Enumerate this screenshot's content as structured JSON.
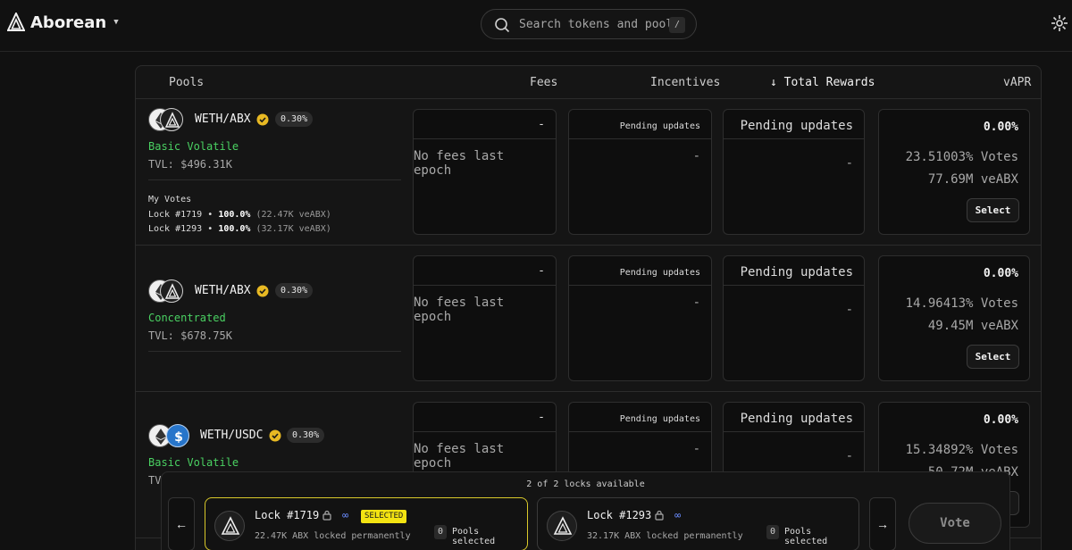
{
  "app": {
    "name": "Aborean"
  },
  "search": {
    "placeholder": "Search tokens and pools",
    "shortcut": "/"
  },
  "table": {
    "headers": {
      "pools": "Pools",
      "fees": "Fees",
      "incentives": "Incentives",
      "total_rewards": "↓ Total Rewards",
      "vapr": "vAPR"
    },
    "rows": [
      {
        "pair": "WETH/ABX",
        "fee": "0.30%",
        "type": "Basic Volatile",
        "tvl": "TVL: $496.31K",
        "my_votes_title": "My Votes",
        "votes": [
          {
            "lock": "Lock #1719",
            "sep": "•",
            "pct": "100.0%",
            "amount": "(22.47K veABX)"
          },
          {
            "lock": "Lock #1293",
            "sep": "•",
            "pct": "100.0%",
            "amount": "(32.17K veABX)"
          }
        ],
        "fees_top": "-",
        "fees_mid": "No fees last epoch",
        "inc_top": "Pending updates",
        "inc_mid": "-",
        "rew_top": "Pending updates",
        "rew_mid": "-",
        "vapr": "0.00%",
        "votes_pct": "23.51003% Votes",
        "veabx": "77.69M veABX",
        "select_label": "Select"
      },
      {
        "pair": "WETH/ABX",
        "fee": "0.30%",
        "type": "Concentrated",
        "tvl": "TVL: $678.75K",
        "fees_top": "-",
        "fees_mid": "No fees last epoch",
        "inc_top": "Pending updates",
        "inc_mid": "-",
        "rew_top": "Pending updates",
        "rew_mid": "-",
        "vapr": "0.00%",
        "votes_pct": "14.96413% Votes",
        "veabx": "49.45M veABX",
        "select_label": "Select"
      },
      {
        "pair": "WETH/USDC",
        "fee": "0.30%",
        "type": "Basic Volatile",
        "tvl": "TVL",
        "fees_top": "-",
        "fees_mid": "No fees last epoch",
        "inc_top": "Pending updates",
        "inc_mid": "-",
        "rew_top": "Pending updates",
        "rew_mid": "-",
        "vapr": "0.00%",
        "votes_pct": "15.34892% Votes",
        "veabx": "50.72M veABX",
        "select_label": "Select"
      }
    ]
  },
  "dock": {
    "title": "2 of 2 locks available",
    "prev": "←",
    "next": "→",
    "locks": [
      {
        "name": "Lock #1719",
        "infinity": "∞",
        "badge": "SELECTED",
        "sub": "22.47K ABX locked permanently",
        "count": "0",
        "pools_label": "Pools selected"
      },
      {
        "name": "Lock #1293",
        "infinity": "∞",
        "sub": "32.17K ABX locked permanently",
        "count": "0",
        "pools_label": "Pools selected"
      }
    ],
    "vote_label": "Vote"
  },
  "colors": {
    "accent_green": "#4ad162",
    "selected_yellow": "#f3e312",
    "verified_gold": "#e8b923",
    "usdc_blue": "#2775ca"
  }
}
